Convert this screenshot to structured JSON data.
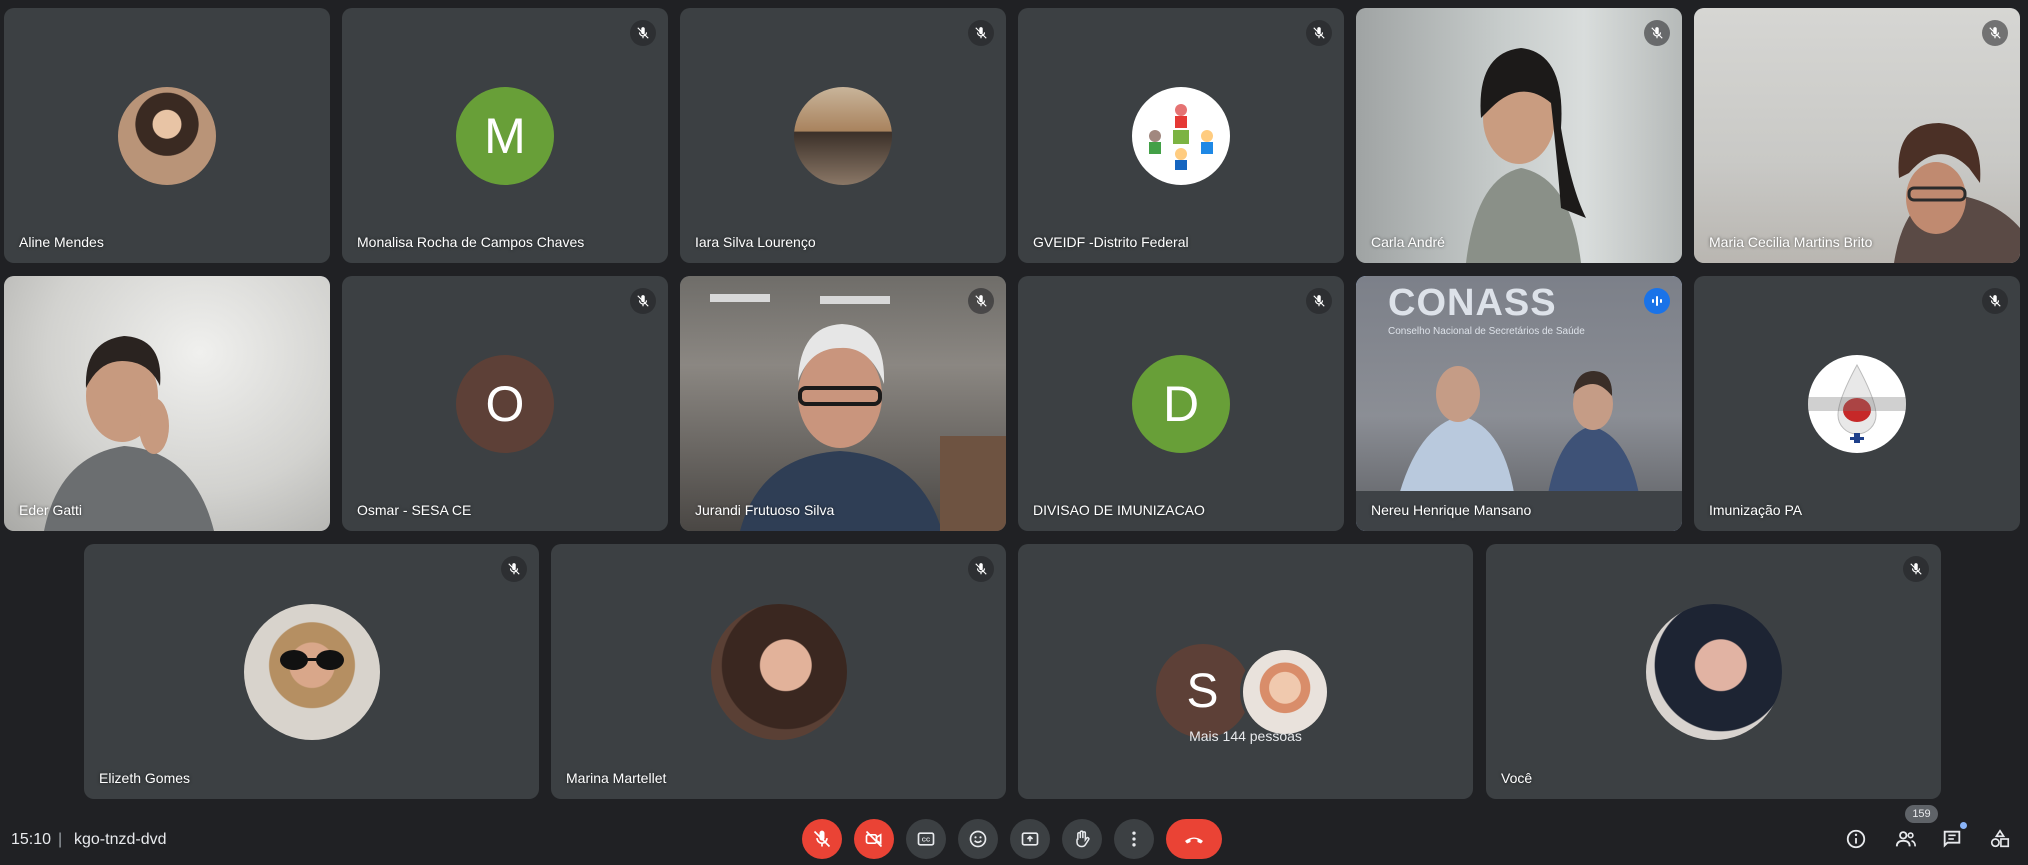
{
  "participants_row1": [
    {
      "name": "Aline Mendes",
      "muted": false,
      "avatar_type": "photo"
    },
    {
      "name": "Monalisa Rocha de Campos Chaves",
      "muted": true,
      "avatar_type": "letter",
      "letter": "M",
      "color": "#689f38"
    },
    {
      "name": "Iara Silva Lourenço",
      "muted": true,
      "avatar_type": "photo"
    },
    {
      "name": "GVEIDF -Distrito Federal",
      "muted": true,
      "avatar_type": "logo"
    },
    {
      "name": "Carla André",
      "muted": true,
      "avatar_type": "video"
    },
    {
      "name": "Maria Cecilia Martins Brito",
      "muted": true,
      "avatar_type": "video"
    }
  ],
  "participants_row2": [
    {
      "name": "Eder Gatti",
      "muted": false,
      "avatar_type": "video"
    },
    {
      "name": "Osmar - SESA CE",
      "muted": true,
      "avatar_type": "letter",
      "letter": "O",
      "color": "#5d4037"
    },
    {
      "name": "Jurandi Frutuoso Silva",
      "muted": true,
      "avatar_type": "video"
    },
    {
      "name": "DIVISAO DE IMUNIZACAO",
      "muted": true,
      "avatar_type": "letter",
      "letter": "D",
      "color": "#689f38"
    },
    {
      "name": "Nereu Henrique Mansano",
      "muted": false,
      "speaking": true,
      "avatar_type": "video"
    },
    {
      "name": "Imunização PA",
      "muted": true,
      "avatar_type": "logo"
    }
  ],
  "participants_row3": [
    {
      "name": "Elizeth Gomes",
      "muted": true,
      "avatar_type": "photo"
    },
    {
      "name": "Marina Martellet",
      "muted": true,
      "avatar_type": "photo"
    },
    {
      "name": "",
      "group": true,
      "letter": "S",
      "more_text": "Mais 144 pessoas"
    },
    {
      "name": "Você",
      "muted": true,
      "avatar_type": "photo"
    }
  ],
  "conass": {
    "title": "CONASS",
    "subtitle": "Conselho Nacional de Secretários de Saúde"
  },
  "bottom_bar": {
    "time": "15:10",
    "separator": "|",
    "meeting_code": "kgo-tnzd-dvd",
    "participant_count": "159"
  },
  "colors": {
    "background": "#202124",
    "tile": "#3c4043",
    "danger": "#ea4335",
    "speaking": "#8ab4f8"
  }
}
